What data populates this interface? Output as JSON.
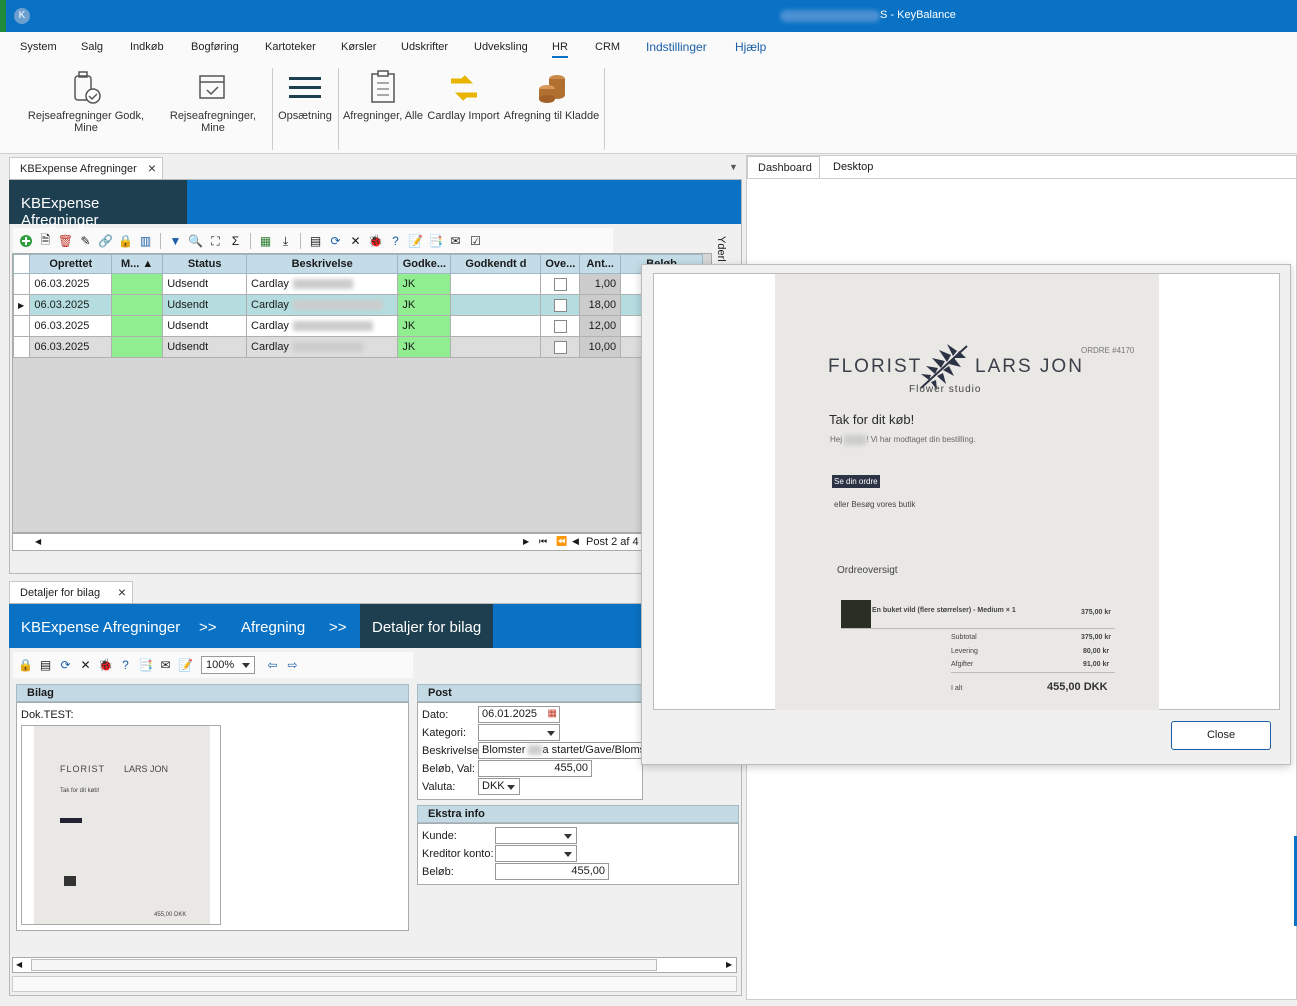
{
  "window": {
    "title": "S - KeyBalance"
  },
  "menu": [
    "System",
    "Salg",
    "Indkøb",
    "Bogføring",
    "Kartoteker",
    "Kørsler",
    "Udskrifter",
    "Udveksling",
    "HR",
    "CRM",
    "Indstillinger",
    "Hjælp"
  ],
  "ribbon": {
    "b1": "Rejseafregninger Godk, Mine",
    "b2": "Rejseafregninger, Mine",
    "b3": "Opsætning",
    "b4": "Afregninger, Alle",
    "b5": "Cardlay Import",
    "b6": "Afregning til Kladde"
  },
  "tabs": {
    "main": "KBExpense Afregninger",
    "details": "Detaljer for bilag",
    "dashboard": "Dashboard",
    "desktop": "Desktop"
  },
  "main_header": "KBExpense Afregninger",
  "grid": {
    "columns": [
      "Oprettet",
      "M...",
      "Status",
      "Beskrivelse",
      "Godke...",
      "Godkendt d",
      "Ove...",
      "Ant...",
      "Beløb"
    ],
    "rows": [
      {
        "date": "06.03.2025",
        "status": "Udsendt",
        "desc": "Cardlay",
        "godk": "JK",
        "ant": "1,00"
      },
      {
        "date": "06.03.2025",
        "status": "Udsendt",
        "desc": "Cardlay",
        "godk": "JK",
        "ant": "18,00"
      },
      {
        "date": "06.03.2025",
        "status": "Udsendt",
        "desc": "Cardlay",
        "godk": "JK",
        "ant": "12,00"
      },
      {
        "date": "06.03.2025",
        "status": "Udsendt",
        "desc": "Cardlay",
        "godk": "JK",
        "ant": "10,00"
      }
    ],
    "pager": "Post 2 af 4",
    "side_label": "Yderl"
  },
  "breadcrumb": [
    "KBExpense Afregninger",
    ">>",
    "Afregning",
    ">>",
    "Detaljer for bilag"
  ],
  "zoom": "100%",
  "bilag": {
    "header": "Bilag",
    "doc": "Dok.TEST:"
  },
  "post": {
    "header": "Post",
    "dato_label": "Dato:",
    "dato": "06.01.2025",
    "kategori_label": "Kategori:",
    "beskrivelse_label": "Beskrivelse:",
    "beskrivelse": "Blomster",
    "beskrivelse2": "a startet/Gave/Bloms",
    "belob_label": "Beløb, Val:",
    "belob": "455,00",
    "valuta_label": "Valuta:",
    "valuta": "DKK"
  },
  "extra": {
    "header": "Ekstra info",
    "kunde_label": "Kunde:",
    "kreditor_label": "Kreditor konto:",
    "belob_label": "Beløb:",
    "belob": "455,00"
  },
  "receipt": {
    "logo_left": "FLORIST",
    "logo_right": "LARS JON",
    "sub": "Flower studio",
    "order": "ORDRE #4170",
    "thanks": "Tak for dit køb!",
    "hej": "Hej",
    "hej2": "! Vi har modtaget din bestilling.",
    "btn": "Se din ordre",
    "eller": "eller Besøg vores butik",
    "overview": "Ordreoversigt",
    "item": "En buket vild (flere størrelser) - Medium × 1",
    "item_price": "375,00 kr",
    "subtotal_l": "Subtotal",
    "subtotal": "375,00 kr",
    "levering_l": "Levering",
    "levering": "80,00 kr",
    "afgifter_l": "Afgifter",
    "afgifter": "91,00 kr",
    "ialt_l": "I alt",
    "ialt": "455,00 DKK"
  },
  "popup": {
    "close": "Close"
  }
}
